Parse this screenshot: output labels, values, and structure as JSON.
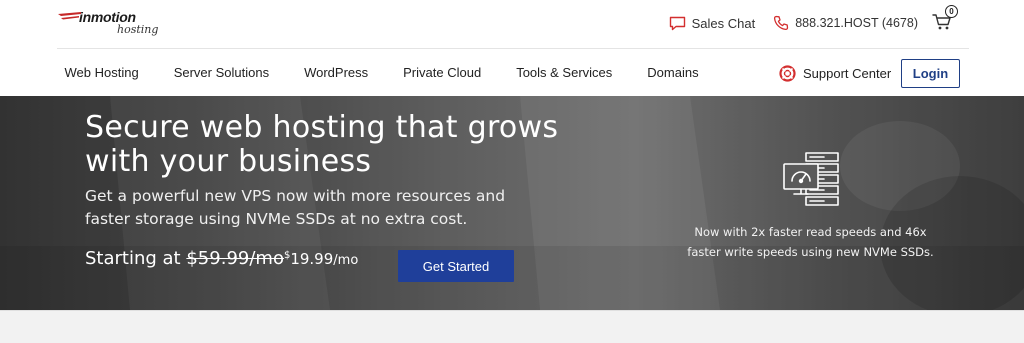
{
  "brand": {
    "logo_main": "inmotion",
    "logo_sub": "hosting"
  },
  "topbar": {
    "sales_chat": "Sales Chat",
    "phone": "888.321.HOST (4678)",
    "cart_count": "0"
  },
  "nav": {
    "items": [
      {
        "label": "Web Hosting"
      },
      {
        "label": "Server Solutions"
      },
      {
        "label": "WordPress"
      },
      {
        "label": "Private Cloud"
      },
      {
        "label": "Tools & Services"
      },
      {
        "label": "Domains"
      }
    ],
    "support": "Support Center",
    "login": "Login"
  },
  "hero": {
    "title": "Secure web hosting that grows with your business",
    "subtitle": "Get a powerful new VPS now with more resources and faster storage using NVMe SSDs at no extra cost.",
    "price_prefix": "Starting at",
    "price_old": "$59.99/mo",
    "price_currency": "$",
    "price_new": "19.99",
    "price_period": "/mo",
    "cta": "Get Started",
    "note": "Now with 2x faster read speeds and 46x faster write speeds using new NVMe SSDs."
  },
  "colors": {
    "accent": "#1f3f9a",
    "login_border": "#1f3f85",
    "icon_red": "#d32f2f"
  },
  "icons": {
    "sales_chat": "chat-bubble-icon",
    "phone": "phone-icon",
    "cart": "shopping-cart-icon",
    "support": "lifebuoy-icon",
    "hero": "server-speedometer-icon"
  }
}
